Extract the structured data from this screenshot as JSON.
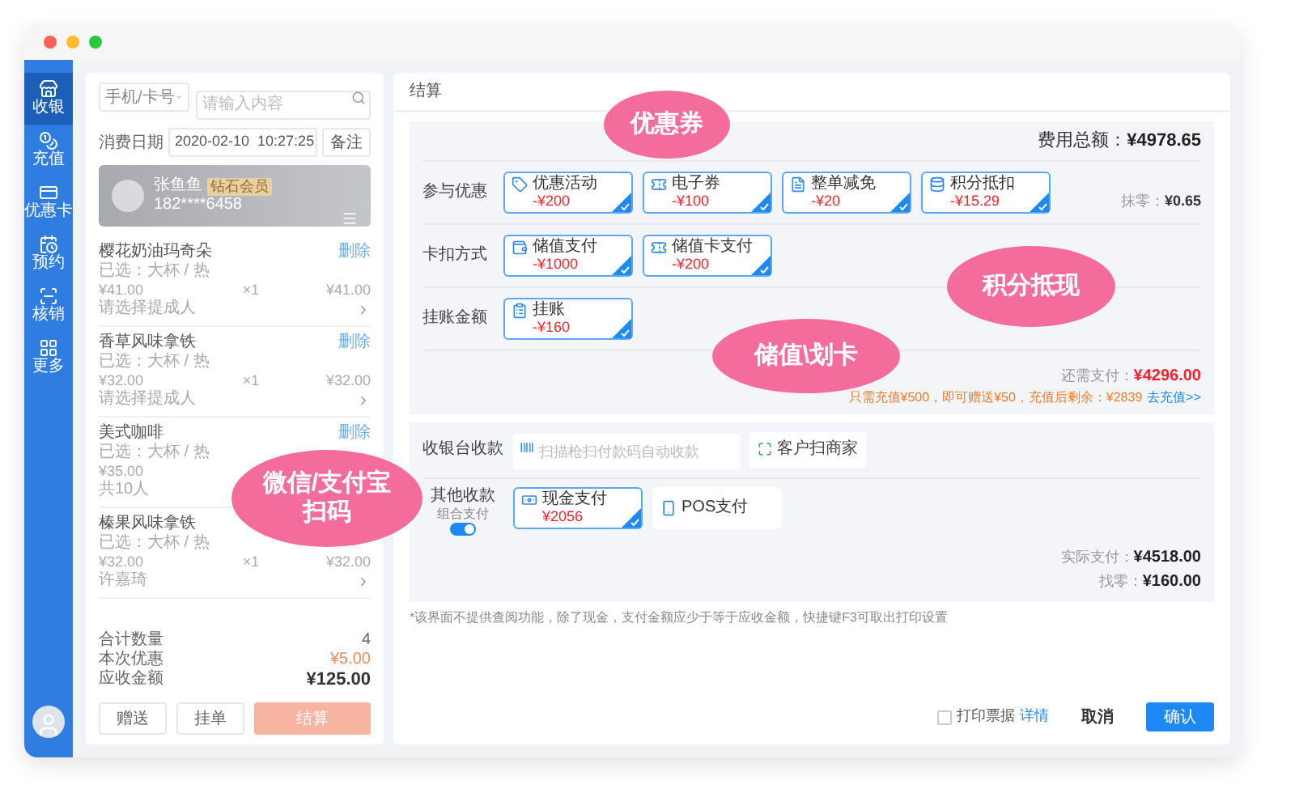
{
  "sidebar": {
    "items": [
      {
        "label": "收银",
        "selected": true
      },
      {
        "label": "充值",
        "selected": false
      },
      {
        "label": "优惠卡",
        "selected": false
      },
      {
        "label": "预约",
        "selected": false
      },
      {
        "label": "核销",
        "selected": false
      },
      {
        "label": "更多",
        "selected": false
      }
    ]
  },
  "order": {
    "search_type": "手机/卡号",
    "search_placeholder": "请输入内容",
    "date_label": "消费日期",
    "date_value": "2020-02-10  10:27:25",
    "note_button": "备注",
    "member": {
      "name": "张鱼鱼",
      "badge": "钻石会员",
      "phone": "182****6458"
    },
    "items": [
      {
        "name": "樱花奶油玛奇朵",
        "action": "删除",
        "spec": "已选：大杯 / 热",
        "price": "¥41.00",
        "qty": "×1",
        "subtotal": "¥41.00",
        "footer": "请选择提成人",
        "kind": "select"
      },
      {
        "name": "香草风味拿铁",
        "action": "删除",
        "spec": "已选：大杯 / 热",
        "price": "¥32.00",
        "qty": "×1",
        "subtotal": "¥32.00",
        "footer": "请选择提成人",
        "kind": "select"
      },
      {
        "name": "美式咖啡",
        "action": "删除",
        "spec": "已选：大杯 / 热",
        "price": "¥35.00",
        "footer": "共10人",
        "kind": "note"
      },
      {
        "name": "榛果风味拿铁",
        "spec": "已选：大杯 / 热",
        "price": "¥32.00",
        "qty": "×1",
        "subtotal": "¥32.00",
        "footer": "许嘉琦",
        "kind": "select"
      }
    ],
    "totals": [
      {
        "label": "合计数量",
        "value": "4",
        "kind": "plain"
      },
      {
        "label": "本次优惠",
        "value": "¥5.00",
        "kind": "discount"
      },
      {
        "label": "应收金额",
        "value": "¥125.00",
        "kind": "total"
      }
    ],
    "buttons": [
      {
        "label": "赠送",
        "kind": "outline"
      },
      {
        "label": "挂单",
        "kind": "outline"
      },
      {
        "label": "结算",
        "kind": "primary"
      }
    ]
  },
  "checkout": {
    "title": "结算",
    "total_label": "费用总额：",
    "total_value": "¥4978.65",
    "rows": [
      {
        "label": "参与优惠",
        "tiles": [
          {
            "label": "优惠活动",
            "amount": "-¥200",
            "selected": true
          },
          {
            "label": "电子券",
            "amount": "-¥100",
            "selected": true
          },
          {
            "label": "整单减免",
            "amount": "-¥20",
            "selected": true
          },
          {
            "label": "积分抵扣",
            "amount": "-¥15.29",
            "selected": true
          }
        ]
      },
      {
        "label": "卡扣方式",
        "tiles": [
          {
            "label": "储值支付",
            "amount": "-¥1000",
            "selected": true
          },
          {
            "label": "储值卡支付",
            "amount": "-¥200",
            "selected": true
          }
        ]
      },
      {
        "label": "挂账金额",
        "tiles": [
          {
            "label": "挂账",
            "amount": "-¥160",
            "selected": true
          }
        ]
      }
    ],
    "rounding_label": "抹零：",
    "rounding_value": "¥0.65",
    "due_label": "还需支付：",
    "due_value": "¥4296.00",
    "promo": "只需充值¥500，即可赠送¥50，充值后剩余：¥2839",
    "promo_link": "去充值>>",
    "cashier_label": "收银台收款",
    "scan_placeholder": "扫描枪扫付款码自动收款",
    "scan_button": "客户扫商家",
    "other_label": "其他收款",
    "combo_label": "组合支付",
    "combo_on": true,
    "other_tiles": [
      {
        "label": "现金支付",
        "amount": "¥2056",
        "selected": true
      },
      {
        "label": "POS支付",
        "selected": false
      }
    ],
    "paid_label": "实际支付：",
    "paid_value": "¥4518.00",
    "change_label": "找零：",
    "change_value": "¥160.00",
    "note": "*该界面不提供查阅功能，除了现金，支付金额应少于等于应收金额，快捷键F3可取出打印设置",
    "print_label": "打印票据",
    "print_checked": false,
    "print_link": "详情",
    "cancel": "取消",
    "confirm": "确认"
  },
  "callouts": [
    {
      "text": "优惠券"
    },
    {
      "text": "积分抵现"
    },
    {
      "text": "储值\\划卡"
    },
    {
      "text": "微信/支付宝扫码"
    }
  ]
}
